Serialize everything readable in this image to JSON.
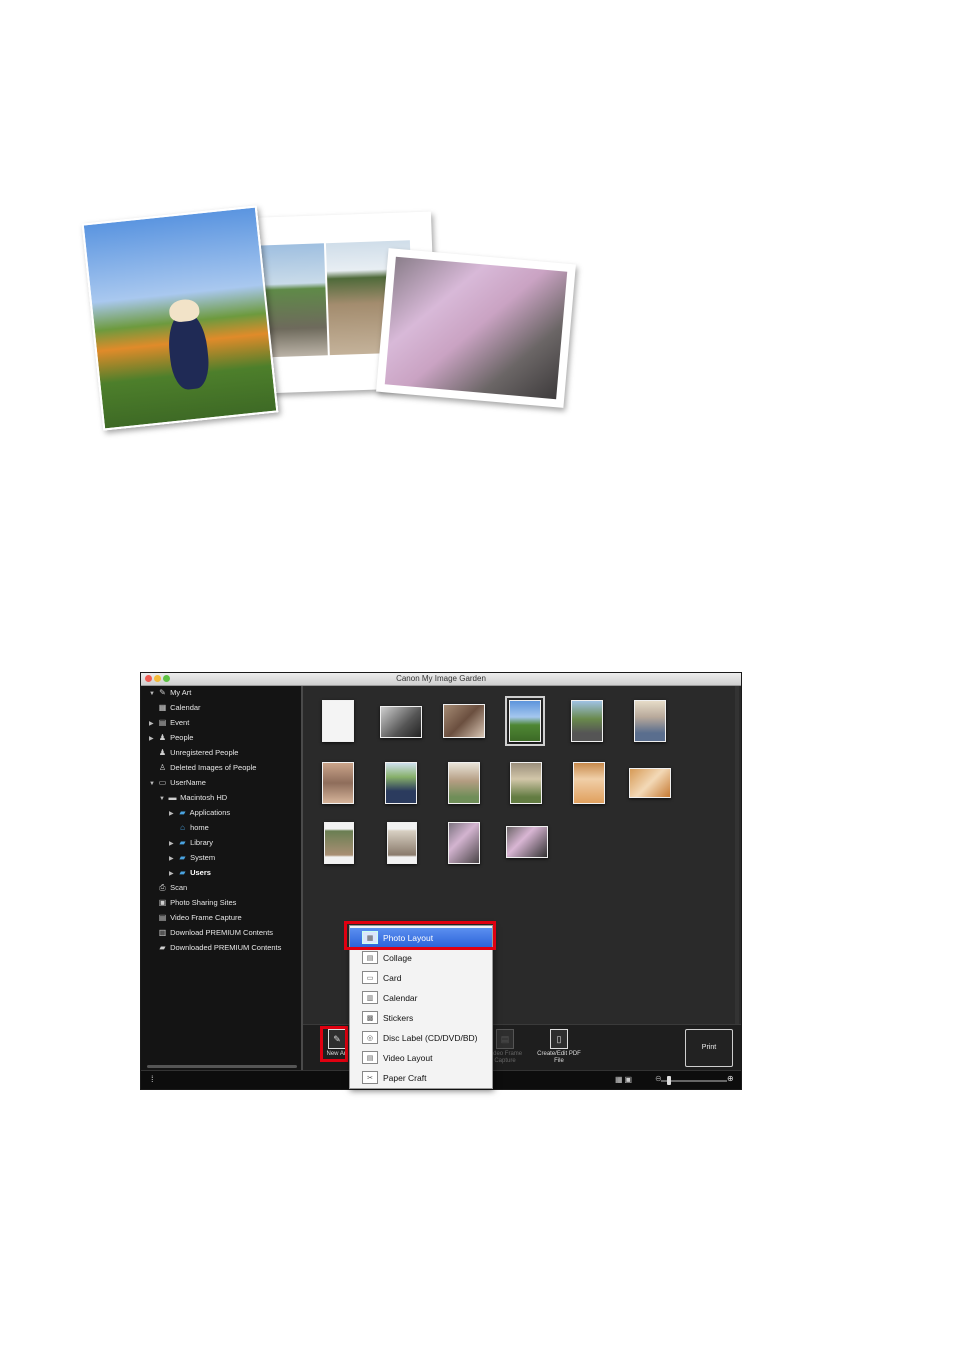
{
  "window": {
    "title": "Canon My Image Garden"
  },
  "sidebar": {
    "items": [
      {
        "label": "My Art",
        "arrow": "▼",
        "icon": "✎"
      },
      {
        "label": "Calendar",
        "arrow": "",
        "icon": "▦"
      },
      {
        "label": "Event",
        "arrow": "▶",
        "icon": "▤"
      },
      {
        "label": "People",
        "arrow": "▶",
        "icon": "♟"
      },
      {
        "label": "Unregistered People",
        "arrow": "",
        "icon": "♟"
      },
      {
        "label": "Deleted Images of People",
        "arrow": "",
        "icon": "♙"
      },
      {
        "label": "UserName",
        "arrow": "▼",
        "icon": "▭"
      },
      {
        "label": "Macintosh HD",
        "arrow": "▼",
        "icon": "▬"
      },
      {
        "label": "Applications",
        "arrow": "▶",
        "icon": "▰"
      },
      {
        "label": "home",
        "arrow": "",
        "icon": "⌂"
      },
      {
        "label": "Library",
        "arrow": "▶",
        "icon": "▰"
      },
      {
        "label": "System",
        "arrow": "▶",
        "icon": "▰"
      },
      {
        "label": "Users",
        "arrow": "▶",
        "icon": "▰"
      },
      {
        "label": "Scan",
        "arrow": "",
        "icon": "⎙"
      },
      {
        "label": "Photo Sharing Sites",
        "arrow": "",
        "icon": "▣"
      },
      {
        "label": "Video Frame Capture",
        "arrow": "",
        "icon": "▤"
      },
      {
        "label": "Download PREMIUM Contents",
        "arrow": "",
        "icon": "▥"
      },
      {
        "label": "Downloaded PREMIUM Contents",
        "arrow": "",
        "icon": "▰"
      }
    ]
  },
  "toolbar": {
    "new_art_label": "New Art",
    "video_frame_label": "Video Frame Capture",
    "pdf_label": "Create/Edit PDF File",
    "print_label": "Print"
  },
  "menu": {
    "items": [
      {
        "label": "Photo Layout",
        "icon": "▦"
      },
      {
        "label": "Collage",
        "icon": "▤"
      },
      {
        "label": "Card",
        "icon": "▭"
      },
      {
        "label": "Calendar",
        "icon": "▥"
      },
      {
        "label": "Stickers",
        "icon": "▩"
      },
      {
        "label": "Disc Label (CD/DVD/BD)",
        "icon": "◎"
      },
      {
        "label": "Video Layout",
        "icon": "▤"
      },
      {
        "label": "Paper Craft",
        "icon": "✂"
      }
    ]
  },
  "statusbar": {
    "info_icon": "⁞",
    "view_icons": "▦▣",
    "zoom_minus": "⊖",
    "zoom_plus": "⊕",
    "zoom_level": 0.1
  }
}
